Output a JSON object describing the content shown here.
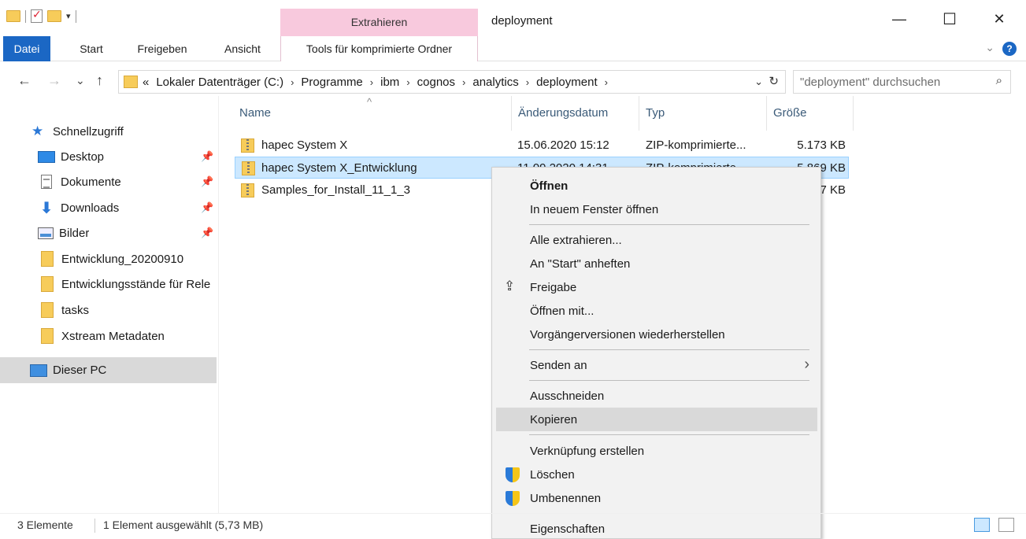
{
  "window": {
    "title": "deployment",
    "context_tab": "Extrahieren",
    "minimize": "—",
    "maximize": "☐",
    "close": "✕"
  },
  "ribbon": {
    "tabs": [
      "Datei",
      "Start",
      "Freigeben",
      "Ansicht"
    ],
    "context_tab_label": "Tools für komprimierte Ordner",
    "help": "?",
    "collapse": "⌄"
  },
  "nav": {
    "back": "←",
    "forward": "→",
    "recent": "⌄",
    "up": "↑",
    "overflow": "«",
    "breadcrumbs": [
      "Lokaler Datenträger (C:)",
      "Programme",
      "ibm",
      "cognos",
      "analytics",
      "deployment"
    ],
    "search_placeholder": "\"deployment\" durchsuchen"
  },
  "sidebar": {
    "items": [
      {
        "label": "Schnellzugriff",
        "icon": "star-icon"
      },
      {
        "label": "Desktop",
        "icon": "desktop-icon",
        "pinned": true
      },
      {
        "label": "Dokumente",
        "icon": "documents-icon",
        "pinned": true
      },
      {
        "label": "Downloads",
        "icon": "downloads-icon",
        "pinned": true
      },
      {
        "label": "Bilder",
        "icon": "pictures-icon",
        "pinned": true
      },
      {
        "label": "Entwicklung_20200910",
        "icon": "folder-icon"
      },
      {
        "label": "Entwicklungsstände für Rele",
        "icon": "folder-icon"
      },
      {
        "label": "tasks",
        "icon": "folder-icon"
      },
      {
        "label": "Xstream Metadaten",
        "icon": "folder-icon"
      },
      {
        "label": "Dieser PC",
        "icon": "pc-icon",
        "selected": true
      }
    ]
  },
  "filelist": {
    "columns": [
      "Name",
      "Änderungsdatum",
      "Typ",
      "Größe"
    ],
    "sort_indicator": "^",
    "rows": [
      {
        "name": "hapec System X",
        "date": "15.06.2020 15:12",
        "type": "ZIP-komprimierte...",
        "size": "5.173 KB"
      },
      {
        "name": "hapec System X_Entwicklung",
        "date": "11.09.2020 14:31",
        "type": "ZIP-komprimierte...",
        "size": "5.869 KB",
        "selected": true
      },
      {
        "name": "Samples_for_Install_11_1_3",
        "date": "",
        "type": "",
        "size": "7 KB"
      }
    ]
  },
  "context_menu": {
    "items": [
      {
        "label": "Öffnen",
        "bold": true
      },
      {
        "label": "In neuem Fenster öffnen"
      },
      {
        "label": "Alle extrahieren..."
      },
      {
        "label": "An \"Start\" anheften"
      },
      {
        "label": "Freigabe",
        "icon": "share-icon"
      },
      {
        "label": "Öffnen mit..."
      },
      {
        "label": "Vorgängerversionen wiederherstellen"
      },
      {
        "label": "Senden an",
        "submenu": true
      },
      {
        "label": "Ausschneiden"
      },
      {
        "label": "Kopieren",
        "highlighted": true
      },
      {
        "label": "Verknüpfung erstellen"
      },
      {
        "label": "Löschen",
        "icon": "shield-icon"
      },
      {
        "label": "Umbenennen",
        "icon": "shield-icon"
      },
      {
        "label": "Eigenschaften"
      }
    ],
    "submenu_arrow": "›"
  },
  "status": {
    "count": "3 Elemente",
    "selection": "1 Element ausgewählt (5,73 MB)"
  },
  "colors": {
    "file_tab": "#1b67c4",
    "context_tab": "#f8c9dd",
    "selection": "#cce8ff",
    "menu_bg": "#f2f2f2",
    "menu_highlight": "#d9d9d9"
  }
}
